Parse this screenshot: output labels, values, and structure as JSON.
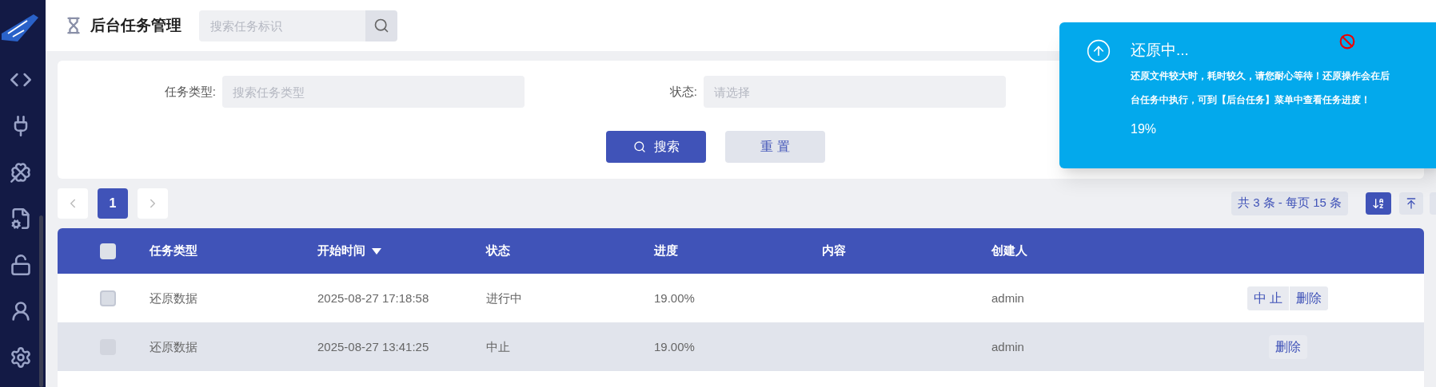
{
  "header": {
    "title": "后台任务管理",
    "search": {
      "placeholder": "搜索任务标识"
    }
  },
  "filters": [
    {
      "label": "任务类型:",
      "placeholder": "搜索任务类型"
    },
    {
      "label": "状态:",
      "placeholder": "请选择"
    }
  ],
  "buttons": {
    "search": "搜索",
    "reset": "重 置"
  },
  "pagination": {
    "pages": [
      {
        "label": "1",
        "selected": true
      }
    ],
    "summary": "共 3 条 - 每页 15 条"
  },
  "table": {
    "select_all_checked": false,
    "columns": [
      {
        "label": "任务类型",
        "sorted_descending": false
      },
      {
        "label": "开始时间",
        "sorted_descending": true
      },
      {
        "label": "状态",
        "sorted_descending": false
      },
      {
        "label": "进度",
        "sorted_descending": false
      },
      {
        "label": "内容",
        "sorted_descending": false
      },
      {
        "label": "创建人",
        "sorted_descending": false
      }
    ],
    "rows": [
      {
        "cells": [
          "还原数据",
          "2025-08-27 17:18:58",
          "进行中",
          "19.00%",
          "",
          "admin"
        ],
        "checkbox_disabled": false,
        "highlighted": false,
        "actions": [
          "中 止",
          "删除"
        ]
      },
      {
        "cells": [
          "还原数据",
          "2025-08-27 13:41:25",
          "中止",
          "19.00%",
          "",
          "admin"
        ],
        "checkbox_disabled": true,
        "highlighted": true,
        "actions": [
          "删除"
        ]
      }
    ]
  },
  "toast": {
    "title": "还原中...",
    "message": "还原文件较大时，耗时较久，请您耐心等待！还原操作会在后台任务中执行，可到【后台任务】菜单中查看任务进度！",
    "progress": "19%"
  }
}
